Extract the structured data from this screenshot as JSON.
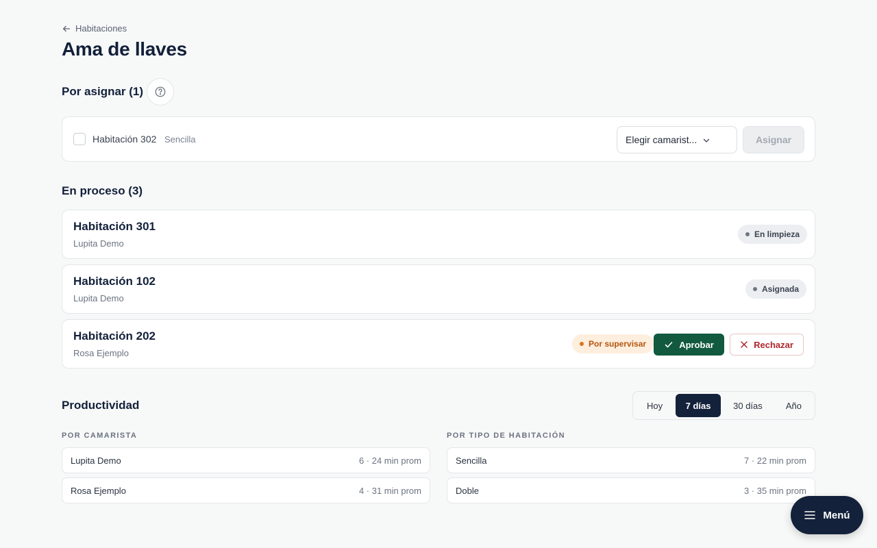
{
  "header": {
    "breadcrumb": "Habitaciones",
    "title": "Ama de llaves"
  },
  "unassigned": {
    "title": "Por asignar (1)",
    "room": "Habitación 302",
    "type": "Sencilla",
    "select_value": "Elegir camarist...",
    "assign_label": "Asignar"
  },
  "in_progress": {
    "title": "En proceso (3)",
    "rooms": [
      {
        "name": "Habitación 301",
        "person": "Lupita Demo",
        "status": "En limpieza"
      },
      {
        "name": "Habitación 102",
        "person": "Lupita Demo",
        "status": "Asignada"
      },
      {
        "name": "Habitación 202",
        "person": "Rosa Ejemplo",
        "status": "Por supervisar",
        "approve_label": "Aprobar",
        "reject_label": "Rechazar"
      }
    ]
  },
  "productivity": {
    "title": "Productividad",
    "ranges": [
      "Hoy",
      "7 días",
      "30 días",
      "Año"
    ],
    "active_range": "7 días",
    "by_housekeeper_label": "POR CAMARISTA",
    "by_room_type_label": "POR TIPO DE HABITACIÓN",
    "by_housekeeper": [
      {
        "name": "Lupita Demo",
        "value": "6 · 24 min prom"
      },
      {
        "name": "Rosa Ejemplo",
        "value": "4 · 31 min prom"
      }
    ],
    "by_room_type": [
      {
        "name": "Sencilla",
        "value": "7 · 22 min prom"
      },
      {
        "name": "Doble",
        "value": "3 · 35 min prom"
      }
    ]
  },
  "menu": {
    "label": "Menú"
  },
  "colors": {
    "primary": "#14213a",
    "approve": "#11593f",
    "reject": "#b0262c",
    "pending_badge_bg": "#fdeede"
  }
}
